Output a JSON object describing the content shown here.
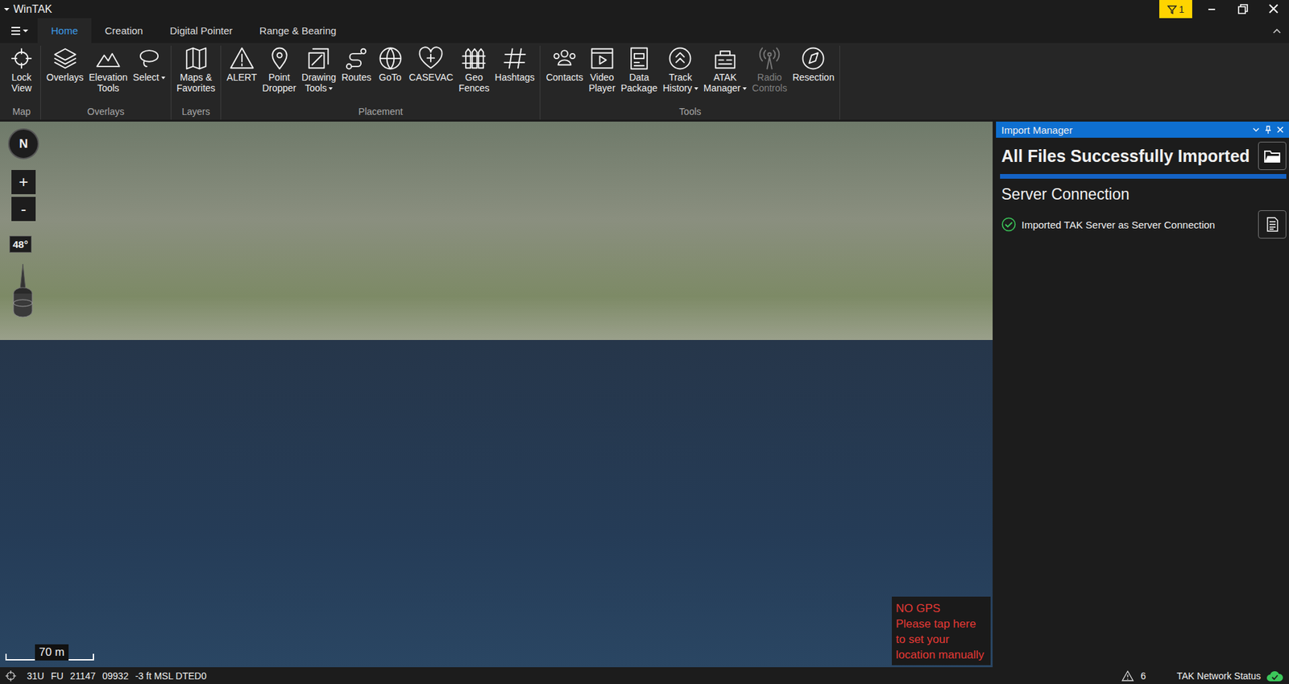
{
  "window": {
    "title": "WinTAK",
    "notification_count": "1"
  },
  "tabs": [
    {
      "label": "Home",
      "selected": true
    },
    {
      "label": "Creation",
      "selected": false
    },
    {
      "label": "Digital Pointer",
      "selected": false
    },
    {
      "label": "Range & Bearing",
      "selected": false
    }
  ],
  "ribbon_groups": [
    {
      "label": "Map",
      "tools": [
        {
          "lines": [
            "Lock",
            "View"
          ],
          "disabled": false,
          "dropdown": false
        }
      ]
    },
    {
      "label": "Overlays",
      "tools": [
        {
          "lines": [
            "Overlays"
          ],
          "disabled": false,
          "dropdown": false
        },
        {
          "lines": [
            "Elevation",
            "Tools"
          ],
          "disabled": false,
          "dropdown": false
        },
        {
          "lines": [
            "Select"
          ],
          "disabled": false,
          "dropdown": true
        }
      ]
    },
    {
      "label": "Layers",
      "tools": [
        {
          "lines": [
            "Maps &",
            "Favorites"
          ],
          "disabled": false,
          "dropdown": false
        }
      ]
    },
    {
      "label": "Placement",
      "tools": [
        {
          "lines": [
            "ALERT"
          ],
          "disabled": false,
          "dropdown": false
        },
        {
          "lines": [
            "Point",
            "Dropper"
          ],
          "disabled": false,
          "dropdown": false
        },
        {
          "lines": [
            "Drawing",
            "Tools"
          ],
          "disabled": false,
          "dropdown": true
        },
        {
          "lines": [
            "Routes"
          ],
          "disabled": false,
          "dropdown": false
        },
        {
          "lines": [
            "GoTo"
          ],
          "disabled": false,
          "dropdown": false
        },
        {
          "lines": [
            "CASEVAC"
          ],
          "disabled": false,
          "dropdown": false
        },
        {
          "lines": [
            "Geo",
            "Fences"
          ],
          "disabled": false,
          "dropdown": false
        },
        {
          "lines": [
            "Hashtags"
          ],
          "disabled": false,
          "dropdown": false
        }
      ]
    },
    {
      "label": "Tools",
      "tools": [
        {
          "lines": [
            "Contacts"
          ],
          "disabled": false,
          "dropdown": false
        },
        {
          "lines": [
            "Video",
            "Player"
          ],
          "disabled": false,
          "dropdown": false
        },
        {
          "lines": [
            "Data",
            "Package"
          ],
          "disabled": false,
          "dropdown": false
        },
        {
          "lines": [
            "Track",
            "History"
          ],
          "disabled": false,
          "dropdown": true
        },
        {
          "lines": [
            "ATAK",
            "Manager"
          ],
          "disabled": false,
          "dropdown": true
        },
        {
          "lines": [
            "Radio",
            "Controls"
          ],
          "disabled": true,
          "dropdown": false
        },
        {
          "lines": [
            "Resection"
          ],
          "disabled": false,
          "dropdown": false
        }
      ]
    }
  ],
  "map": {
    "compass_label": "N",
    "zoom_in": "+",
    "zoom_out": "-",
    "tilt": "48°",
    "scale": "70 m",
    "gps_warning": {
      "title": "NO GPS",
      "message": "Please tap here to set your location manually"
    }
  },
  "panel": {
    "title": "Import Manager",
    "status": "All Files Successfully Imported",
    "sections": [
      {
        "title": "Server Connection",
        "items": [
          {
            "text": "Imported TAK Server as Server Connection",
            "success": true
          }
        ]
      }
    ]
  },
  "status_bar": {
    "grid": "31U",
    "square": "FU",
    "easting": "21147",
    "northing": "09932",
    "elevation": "-3 ft MSL DTED0",
    "alert_count": "6",
    "network_label": "TAK Network Status",
    "network_connected": true
  }
}
